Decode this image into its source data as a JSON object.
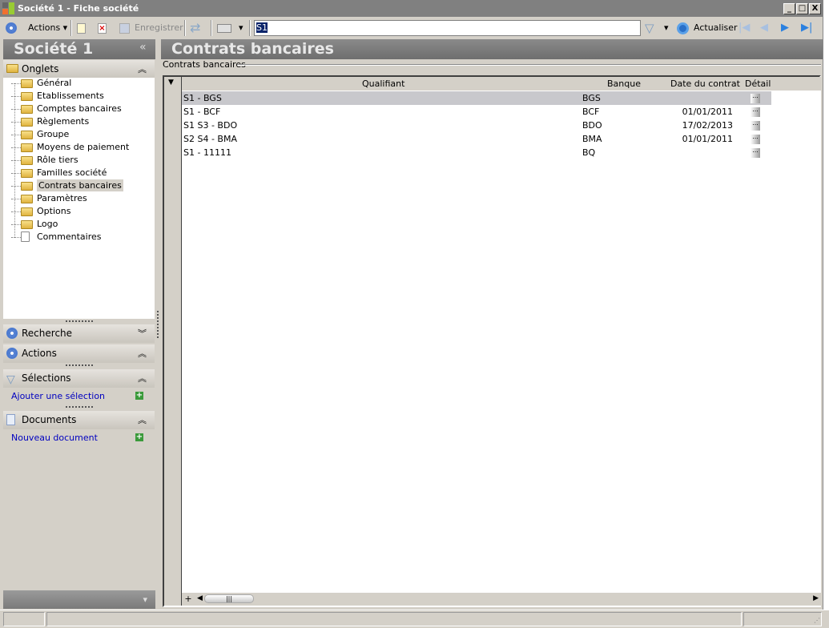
{
  "window": {
    "title": "Société 1 - Fiche société",
    "minimize": "_",
    "maximize": "□",
    "close": "X"
  },
  "toolbar": {
    "actions_label": "Actions",
    "save_label": "Enregistrer",
    "search_value": "S1",
    "refresh_label": "Actualiser"
  },
  "left": {
    "title": "Société 1",
    "collapse": "«",
    "onglets": {
      "label": "Onglets",
      "items": [
        "Général",
        "Etablissements",
        "Comptes bancaires",
        "Règlements",
        "Groupe",
        "Moyens de paiement",
        "Rôle tiers",
        "Familles société",
        "Contrats bancaires",
        "Paramètres",
        "Options",
        "Logo",
        "Commentaires"
      ],
      "selected": "Contrats bancaires"
    },
    "recherche": "Recherche",
    "actions": "Actions",
    "selections": {
      "label": "Sélections",
      "link": "Ajouter une sélection"
    },
    "documents": {
      "label": "Documents",
      "link": "Nouveau document"
    }
  },
  "main": {
    "title": "Contrats bancaires",
    "group_label": "Contrats bancaires",
    "columns": [
      "Qualifiant",
      "Banque",
      "Date du contrat",
      "Détail"
    ],
    "rows": [
      {
        "qualifiant": "S1 - BGS",
        "banque": "BGS",
        "date": "",
        "detail": "..."
      },
      {
        "qualifiant": "S1 - BCF",
        "banque": "BCF",
        "date": "01/01/2011",
        "detail": "..."
      },
      {
        "qualifiant": "S1 S3 - BDO",
        "banque": "BDO",
        "date": "17/02/2013",
        "detail": "..."
      },
      {
        "qualifiant": "S2 S4 - BMA",
        "banque": "BMA",
        "date": "01/01/2011",
        "detail": "..."
      },
      {
        "qualifiant": "S1 - 11111",
        "banque": "BQ",
        "date": "",
        "detail": "..."
      }
    ],
    "add_row": "+"
  }
}
